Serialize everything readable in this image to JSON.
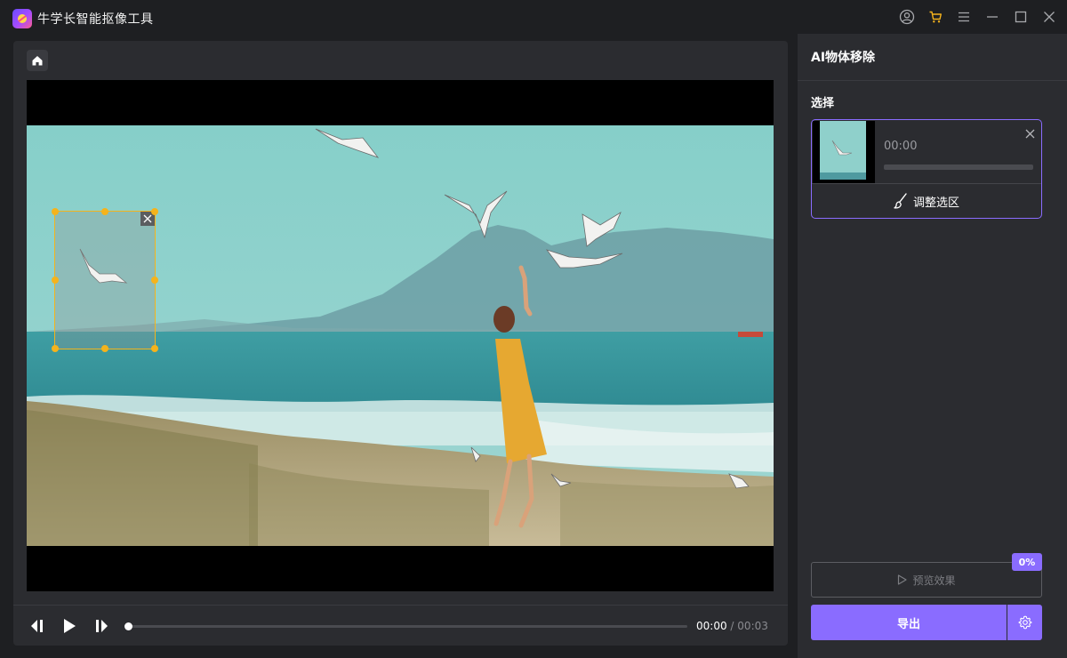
{
  "app": {
    "title": "牛学长智能抠像工具"
  },
  "titlebar": {
    "icons": [
      "account-icon",
      "cart-icon",
      "menu-icon",
      "minimize-icon",
      "maximize-icon",
      "close-icon"
    ],
    "cart_color": "#f5b31c"
  },
  "player": {
    "current_time": "00:00",
    "separator": "/",
    "total_time": "00:03",
    "progress": 0
  },
  "sidebar": {
    "title": "AI物体移除",
    "section_label": "选择",
    "selection_card": {
      "time": "00:00",
      "progress": 0,
      "adjust_label": "调整选区"
    },
    "preview_label": "预览效果",
    "preview_percent": "0%",
    "export_label": "导出"
  },
  "colors": {
    "accent": "#8a6cff",
    "selection_box": "#f5b31c",
    "background": "#1e1f22",
    "panel": "#2b2c30"
  }
}
